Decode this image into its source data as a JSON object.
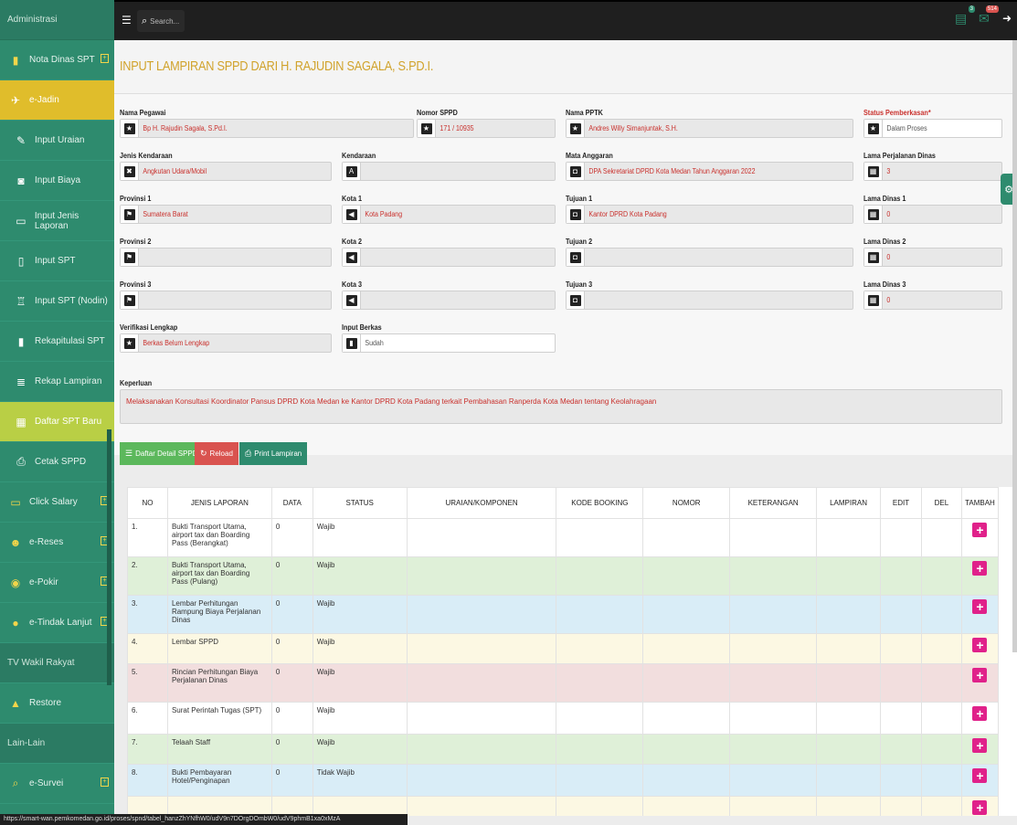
{
  "sidebar": {
    "heading": "Administrasi",
    "items": [
      {
        "label": "Nota Dinas SPT",
        "icon": "book-icon",
        "type": "main",
        "expand": true
      },
      {
        "label": "e-Jadin",
        "icon": "plane-icon",
        "type": "active",
        "expand": false
      },
      {
        "label": "Input Uraian",
        "icon": "edit-icon",
        "type": "sub"
      },
      {
        "label": "Input Biaya",
        "icon": "money-icon",
        "type": "sub"
      },
      {
        "label": "Input Jenis Laporan",
        "icon": "laptop-icon",
        "type": "sub"
      },
      {
        "label": "Input SPT",
        "icon": "file-icon",
        "type": "sub"
      },
      {
        "label": "Input SPT (Nodin)",
        "icon": "gift-icon",
        "type": "sub"
      },
      {
        "label": "Rekapitulasi SPT",
        "icon": "bookmark-icon",
        "type": "sub"
      },
      {
        "label": "Rekap Lampiran",
        "icon": "stack-icon",
        "type": "sub"
      },
      {
        "label": "Daftar SPT Baru",
        "icon": "table-icon",
        "type": "current"
      },
      {
        "label": "Cetak SPPD",
        "icon": "print-icon",
        "type": "sub"
      },
      {
        "label": "Click Salary",
        "icon": "laptop-icon",
        "type": "main",
        "expand": true
      },
      {
        "label": "e-Reses",
        "icon": "users-icon",
        "type": "main",
        "expand": true
      },
      {
        "label": "e-Pokir",
        "icon": "target-icon",
        "type": "main",
        "expand": true
      },
      {
        "label": "e-Tindak Lanjut",
        "icon": "alert-icon",
        "type": "main",
        "expand": true
      }
    ],
    "section_tv": "TV Wakil Rakyat",
    "restore": "Restore",
    "section_lain": "Lain-Lain",
    "survei": "e-Survei"
  },
  "topbar": {
    "search_placeholder": "Search...",
    "badge_1": "3",
    "badge_2": "514"
  },
  "page": {
    "title": "INPUT LAMPIRAN SPPD DARI H. RAJUDIN SAGALA, S.PD.I."
  },
  "form": {
    "nama_pegawai": {
      "label": "Nama Pegawai",
      "value": "Bp H. Rajudin Sagala, S.Pd.I."
    },
    "nomor_sppd": {
      "label": "Nomor SPPD",
      "value": "171 / 10935"
    },
    "nama_pptk": {
      "label": "Nama PPTK",
      "value": "Andres Willy Simanjuntak, S.H."
    },
    "status": {
      "label": "Status Pemberkasan*",
      "value": "Dalam Proses"
    },
    "jenis_kendaraan": {
      "label": "Jenis Kendaraan",
      "value": "Angkutan Udara/Mobil"
    },
    "kendaraan": {
      "label": "Kendaraan",
      "value": ""
    },
    "mata_anggaran": {
      "label": "Mata Anggaran",
      "value": "DPA Sekretariat DPRD Kota Medan Tahun Anggaran 2022"
    },
    "lama_perjalanan": {
      "label": "Lama Perjalanan Dinas",
      "value": "3"
    },
    "provinsi_1": {
      "label": "Provinsi 1",
      "value": "Sumatera Barat"
    },
    "kota_1": {
      "label": "Kota 1",
      "value": "Kota Padang"
    },
    "tujuan_1": {
      "label": "Tujuan 1",
      "value": "Kantor DPRD Kota Padang"
    },
    "lama_1": {
      "label": "Lama Dinas 1",
      "value": "0"
    },
    "provinsi_2": {
      "label": "Provinsi 2",
      "value": ""
    },
    "kota_2": {
      "label": "Kota 2",
      "value": ""
    },
    "tujuan_2": {
      "label": "Tujuan 2",
      "value": ""
    },
    "lama_2": {
      "label": "Lama Dinas 2",
      "value": "0"
    },
    "provinsi_3": {
      "label": "Provinsi 3",
      "value": ""
    },
    "kota_3": {
      "label": "Kota 3",
      "value": ""
    },
    "tujuan_3": {
      "label": "Tujuan 3",
      "value": ""
    },
    "lama_3": {
      "label": "Lama Dinas 3",
      "value": "0"
    },
    "verifikasi": {
      "label": "Verifikasi Lengkap",
      "value": "Berkas Belum Lengkap"
    },
    "input_berkas": {
      "label": "Input Berkas",
      "value": "Sudah"
    },
    "keperluan": {
      "label": "Keperluan",
      "value": "Melaksanakan Konsultasi Koordinator Pansus DPRD Kota Medan ke Kantor DPRD Kota Padang terkait Pembahasan Ranperda Kota Medan tentang Keolahragaan"
    }
  },
  "buttons": {
    "daftar": "Daftar Detail SPPD",
    "reload": "Reload",
    "print": "Print Lampiran",
    "colors": {
      "daftar": "#5cb85c",
      "reload": "#d9534f",
      "print": "#2e8b6e"
    }
  },
  "table": {
    "headers": [
      "NO",
      "JENIS LAPORAN",
      "DATA",
      "STATUS",
      "URAIAN/KOMPONEN",
      "KODE BOOKING",
      "NOMOR",
      "KETERANGAN",
      "LAMPIRAN",
      "EDIT",
      "DEL",
      "TAMBAH"
    ],
    "rows": [
      {
        "no": "1.",
        "jenis": "Bukti Transport Utama, airport tax dan Boarding Pass (Berangkat)",
        "data": "0",
        "status": "Wajib"
      },
      {
        "no": "2.",
        "jenis": "Bukti Transport Utama, airport tax dan Boarding Pass (Pulang)",
        "data": "0",
        "status": "Wajib"
      },
      {
        "no": "3.",
        "jenis": "Lembar Perhitungan Rampung Biaya Perjalanan Dinas",
        "data": "0",
        "status": "Wajib"
      },
      {
        "no": "4.",
        "jenis": "Lembar SPPD",
        "data": "0",
        "status": "Wajib"
      },
      {
        "no": "5.",
        "jenis": "Rincian Perhitungan Biaya Perjalanan Dinas",
        "data": "0",
        "status": "Wajib"
      },
      {
        "no": "6.",
        "jenis": "Surat Perintah Tugas (SPT)",
        "data": "0",
        "status": "Wajib"
      },
      {
        "no": "7.",
        "jenis": "Telaah Staff",
        "data": "0",
        "status": "Wajib"
      },
      {
        "no": "8.",
        "jenis": "Bukti Pembayaran Hotel/Penginapan",
        "data": "0",
        "status": "Tidak Wajib"
      },
      {
        "no": "",
        "jenis": "",
        "data": "",
        "status": ""
      }
    ]
  },
  "statusbar": "https://smart-wan.pemkomedan.go.id/proses/spnd/tabel_hanzZhYNfhW0/udV9n7DOrgDOmbW0/udV9phmB1xa0xMzA"
}
